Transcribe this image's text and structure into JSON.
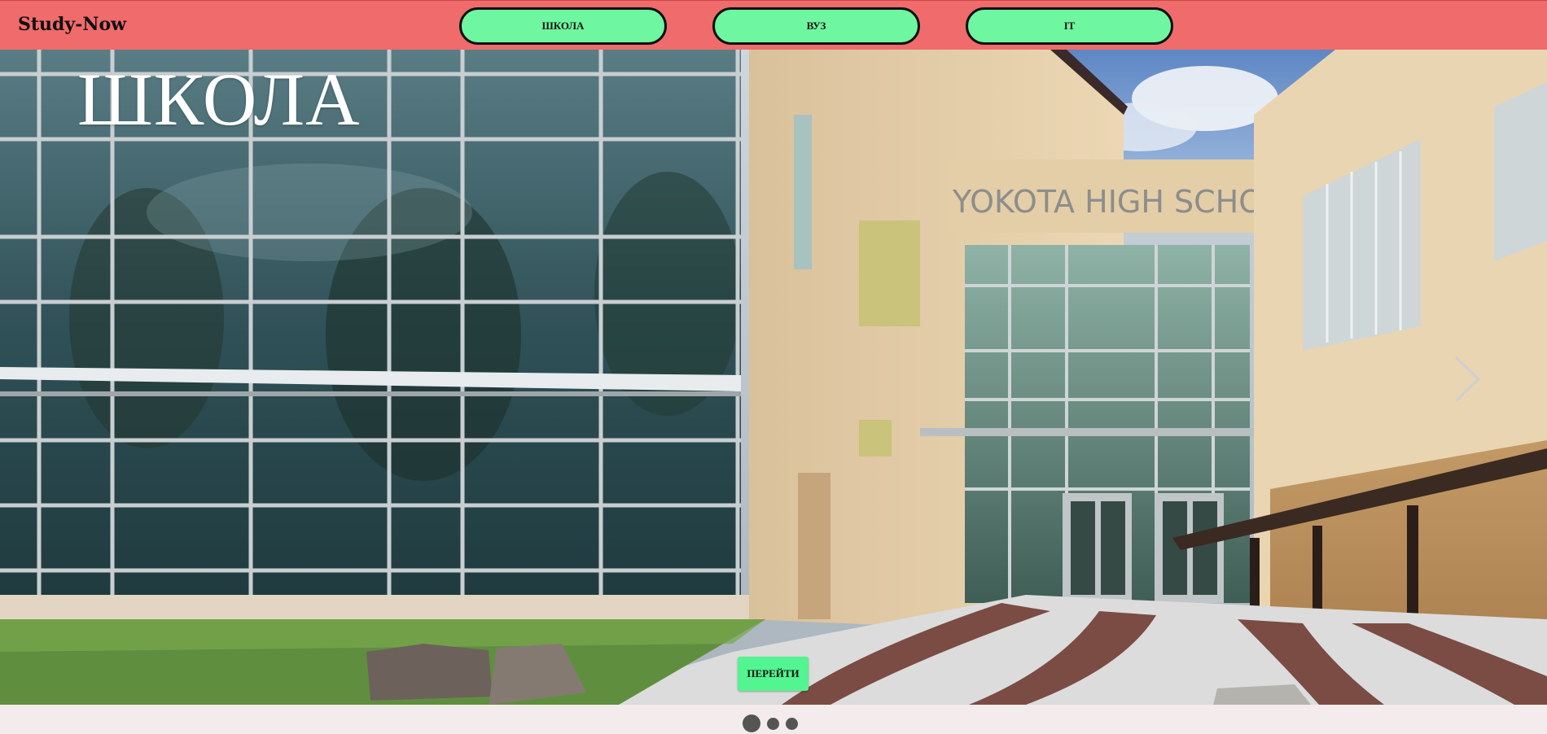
{
  "header": {
    "brand": "Study-Now",
    "nav": [
      {
        "label": "ШКОЛА"
      },
      {
        "label": "ВУЗ"
      },
      {
        "label": "IT"
      }
    ]
  },
  "hero": {
    "title": "ШКОЛА",
    "sign_text": "YOKOTA HIGH SCHOOL",
    "go_label": "ПЕРЕЙТИ"
  },
  "carousel": {
    "slide_count": 3,
    "active_index": 0
  },
  "colors": {
    "header_bg": "#f06b6b",
    "nav_button": "#6ef7a0",
    "go_button": "#52f590",
    "page_bg": "#f4ecec"
  }
}
